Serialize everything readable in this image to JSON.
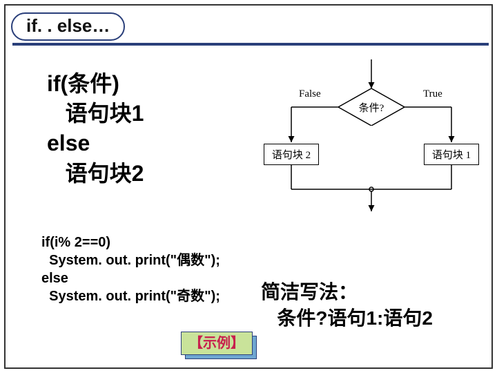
{
  "title": "if. . else…",
  "big_code": "if(条件)\n   语句块1\nelse\n   语句块2",
  "flowchart": {
    "false_label": "False",
    "true_label": "True",
    "condition": "条件?",
    "block2": "语句块 2",
    "block1": "语句块 1"
  },
  "small_code": "if(i% 2==0)\n  System. out. print(\"偶数\");\nelse\n  System. out. print(\"奇数\");",
  "short_writing": "简洁写法：\n   条件?语句1:语句2",
  "example_button": "【示例】"
}
